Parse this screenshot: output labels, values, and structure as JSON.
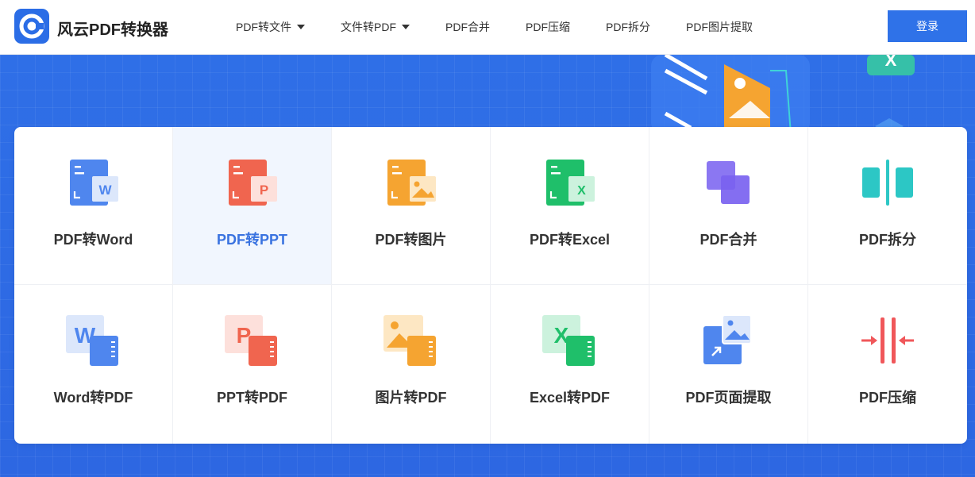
{
  "header": {
    "brand": "风云PDF转换器",
    "logo_icon": "app-logo-icon",
    "nav": [
      {
        "label": "PDF转文件",
        "dropdown": true
      },
      {
        "label": "文件转PDF",
        "dropdown": true
      },
      {
        "label": "PDF合并"
      },
      {
        "label": "PDF压缩"
      },
      {
        "label": "PDF拆分"
      },
      {
        "label": "PDF图片提取"
      }
    ],
    "login_label": "登录"
  },
  "colors": {
    "brand_blue": "#2f72e8",
    "active_text": "#3a73e0",
    "word": "#4f86ee",
    "ppt": "#f0654f",
    "image": "#f5a431",
    "excel": "#1fbf6a",
    "merge": "#7a62f0",
    "split": "#2cc7c5",
    "compress": "#f0575a"
  },
  "tools": [
    {
      "label": "PDF转Word",
      "icon": "pdf-to-word-icon",
      "active": false
    },
    {
      "label": "PDF转PPT",
      "icon": "pdf-to-ppt-icon",
      "active": true
    },
    {
      "label": "PDF转图片",
      "icon": "pdf-to-image-icon",
      "active": false
    },
    {
      "label": "PDF转Excel",
      "icon": "pdf-to-excel-icon",
      "active": false
    },
    {
      "label": "PDF合并",
      "icon": "pdf-merge-icon",
      "active": false
    },
    {
      "label": "PDF拆分",
      "icon": "pdf-split-icon",
      "active": false
    },
    {
      "label": "Word转PDF",
      "icon": "word-to-pdf-icon",
      "active": false
    },
    {
      "label": "PPT转PDF",
      "icon": "ppt-to-pdf-icon",
      "active": false
    },
    {
      "label": "图片转PDF",
      "icon": "image-to-pdf-icon",
      "active": false
    },
    {
      "label": "Excel转PDF",
      "icon": "excel-to-pdf-icon",
      "active": false
    },
    {
      "label": "PDF页面提取",
      "icon": "pdf-page-extract-icon",
      "active": false
    },
    {
      "label": "PDF压缩",
      "icon": "pdf-compress-icon",
      "active": false
    }
  ]
}
